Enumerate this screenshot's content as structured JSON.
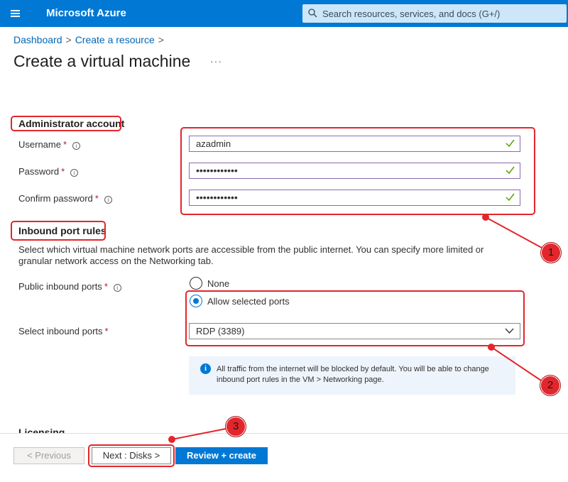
{
  "topbar": {
    "brand": "Microsoft Azure",
    "search_placeholder": "Search resources, services, and docs (G+/)",
    "color": "#0078d4"
  },
  "breadcrumb": {
    "items": [
      "Dashboard",
      "Create a resource"
    ],
    "separator": ">"
  },
  "page": {
    "title": "Create a virtual machine",
    "more_label": "···"
  },
  "admin": {
    "heading": "Administrator account",
    "username_label": "Username",
    "username_value": "azadmin",
    "password_label": "Password",
    "password_value": "••••••••••••",
    "confirm_label": "Confirm password",
    "confirm_value": "••••••••••••",
    "required_mark": "*",
    "info_glyph": "i"
  },
  "inbound": {
    "heading": "Inbound port rules",
    "description": "Select which virtual machine network ports are accessible from the public internet. You can specify more limited or granular network access on the Networking tab.",
    "public_label": "Public inbound ports",
    "option_none": "None",
    "option_allow": "Allow selected ports",
    "selected_option": "Allow selected ports",
    "select_label": "Select inbound ports",
    "select_value": "RDP (3389)",
    "info_text": "All traffic from the internet will be blocked by default. You will be able to change inbound port rules in the VM > Networking page."
  },
  "licensing": {
    "heading": "Licensing"
  },
  "footer": {
    "previous_label": "< Previous",
    "next_label": "Next : Disks >",
    "review_label": "Review + create"
  },
  "annotations": {
    "markers": [
      "1",
      "2",
      "3"
    ],
    "color": "#e3262c"
  },
  "icons": {
    "menu": "hamburger-icon",
    "search": "search-icon",
    "valid": "checkmark-icon",
    "info": "info-icon",
    "dropdown": "chevron-down-icon"
  }
}
